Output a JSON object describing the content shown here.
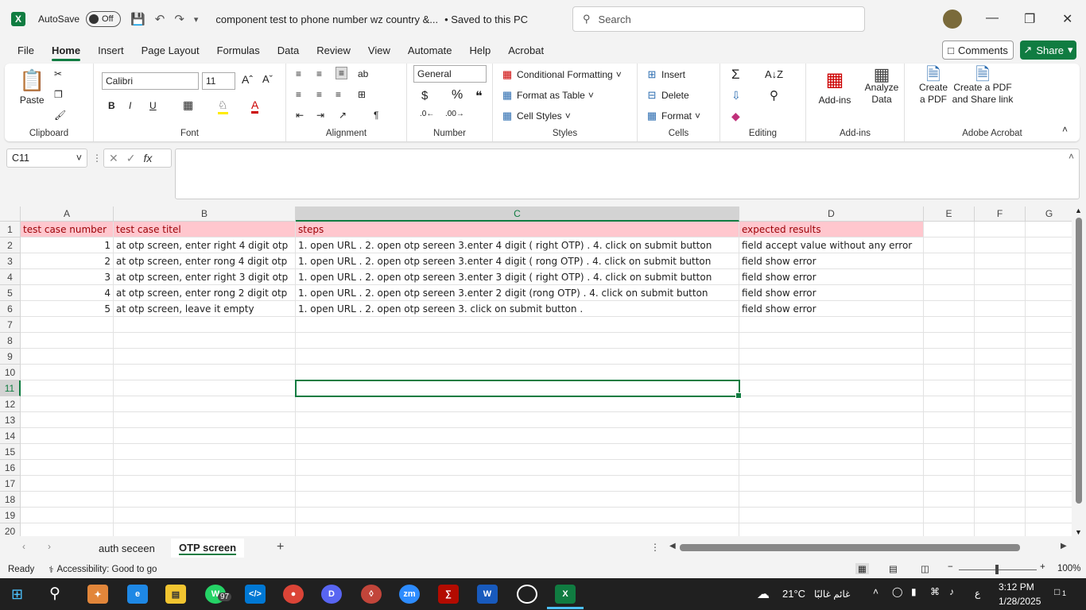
{
  "titlebar": {
    "autosave": "AutoSave",
    "toggle": "Off",
    "doc_title": "component test to phone number wz country &...",
    "saved": "• Saved to this PC",
    "search_placeholder": "Search"
  },
  "menu": [
    "File",
    "Home",
    "Insert",
    "Page Layout",
    "Formulas",
    "Data",
    "Review",
    "View",
    "Automate",
    "Help",
    "Acrobat"
  ],
  "menu_active": "Home",
  "buttons": {
    "comments": "Comments",
    "share": "Share"
  },
  "ribbon": {
    "clipboard": {
      "label": "Clipboard",
      "paste": "Paste"
    },
    "font": {
      "label": "Font",
      "name": "Calibri",
      "size": "11",
      "bold": "B",
      "italic": "I",
      "underline": "U"
    },
    "alignment": {
      "label": "Alignment"
    },
    "number": {
      "label": "Number",
      "format": "General",
      "currency": "$",
      "percent": "%"
    },
    "styles": {
      "label": "Styles",
      "cond": "Conditional Formatting",
      "table": "Format as Table",
      "cell": "Cell Styles"
    },
    "cells": {
      "label": "Cells",
      "insert": "Insert",
      "delete": "Delete",
      "format": "Format"
    },
    "editing": {
      "label": "Editing"
    },
    "addins": {
      "label": "Add-ins",
      "addins": "Add-ins",
      "analyze": "Analyze Data"
    },
    "acrobat": {
      "label": "Adobe Acrobat",
      "create": "Create a PDF",
      "share": "Create a PDF and Share link"
    }
  },
  "formula": {
    "namebox": "C11",
    "fx": "fx",
    "value": ""
  },
  "columns": [
    {
      "id": "A"
    },
    {
      "id": "B"
    },
    {
      "id": "C"
    },
    {
      "id": "D"
    },
    {
      "id": "E"
    },
    {
      "id": "F"
    },
    {
      "id": "G"
    }
  ],
  "rows": [
    [
      "test case number",
      "test case titel",
      "steps",
      "expected results"
    ],
    [
      "1",
      "at otp screen, enter right 4 digit otp",
      "1. open URL . 2. open otp sereen  3.enter 4 digit  ( right OTP) . 4. click on  submit button",
      "field accept value without any error"
    ],
    [
      "2",
      "at otp screen, enter rong 4 digit otp",
      "1. open URL . 2. open otp sereen  3.enter 4 digit  ( rong OTP) . 4. click on  submit button",
      "field show error"
    ],
    [
      "3",
      "at otp screen, enter right 3 digit otp",
      "1. open URL . 2. open otp sereen  3.enter 3 digit  ( right OTP) . 4. click on  submit button",
      "field show error"
    ],
    [
      "4",
      "at otp screen, enter rong 2 digit otp",
      "1. open URL . 2. open otp sereen  3.enter 2 digit  (rong OTP)  . 4. click on  submit button",
      "field show error"
    ],
    [
      "5",
      "at otp screen, leave it empty",
      "1. open URL . 2. open otp sereen  3. click on  submit button .",
      "field show error"
    ]
  ],
  "row_numbers": [
    "1",
    "2",
    "3",
    "4",
    "5",
    "6",
    "7",
    "8",
    "9",
    "10",
    "11",
    "12",
    "13",
    "14",
    "15",
    "16",
    "17",
    "18",
    "19",
    "20"
  ],
  "selected_cell": "C11",
  "sheets": [
    "auth seceen",
    "OTP screen"
  ],
  "active_sheet": "OTP screen",
  "status": {
    "ready": "Ready",
    "accessibility": "Accessibility: Good to go",
    "zoom": "100%"
  },
  "taskbar": {
    "weather": "21°C",
    "weather_text": "غائم غالبًا",
    "time": "3:12 PM",
    "date": "1/28/2025",
    "lang": "ع",
    "whatsapp_badge": "97",
    "notif": "1"
  },
  "colors": {
    "accent": "#107c41",
    "bad_fill": "#ffc7ce",
    "bad_text": "#9c0006"
  }
}
